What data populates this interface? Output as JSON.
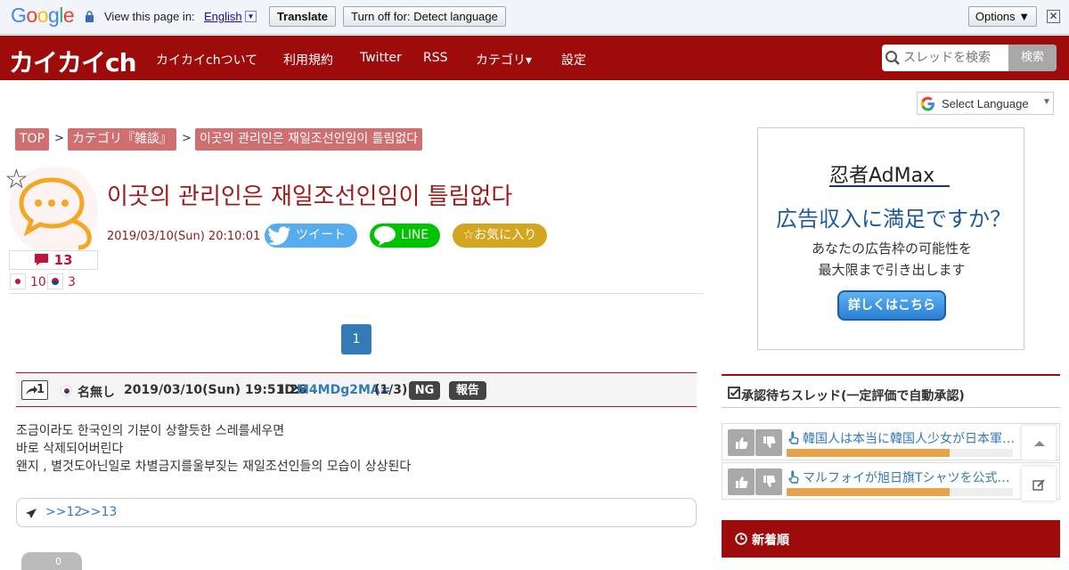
{
  "translate_bar": {
    "google_letters": [
      "G",
      "o",
      "o",
      "g",
      "l",
      "e"
    ],
    "google_colors": [
      "#4285f4",
      "#ea4335",
      "#fbbc05",
      "#4285f4",
      "#34a853",
      "#ea4335"
    ],
    "view_text": "View this page in:",
    "language": "English",
    "translate_label": "Translate",
    "turn_off_label": "Turn off for: Detect language",
    "options_label": "Options ▼",
    "close_label": "✕"
  },
  "header": {
    "logo": "カイカイch",
    "nav": [
      "カイカイchついて",
      "利用規約",
      "Twitter",
      "RSS",
      "カテゴリ▾",
      "設定"
    ],
    "search_placeholder": "スレッドを検索",
    "search_button": "検索",
    "brand_color": "#9e0b0b"
  },
  "select_language": {
    "label": "Select Language",
    "caret": "▼"
  },
  "breadcrumb": {
    "items": [
      "TOP",
      "カテゴリ『雑談』",
      "이곳의 관리인은 재일조선인임이 틀림없다"
    ],
    "separator": ">"
  },
  "thread": {
    "title": "이곳의 관리인은 재일조선인임이 틀림없다",
    "date": "2019/03/10(Sun) 20:10:01",
    "tweet_label": "ツイート",
    "line_label": "LINE",
    "fav_label": "☆お気に入り",
    "comment_count": "13",
    "jp_count": "10",
    "kr_count": "3",
    "star_icon": "☆"
  },
  "pagination": {
    "current": "1"
  },
  "post": {
    "number": "1",
    "name": "名無し",
    "datetime": "2019/03/10(Sun) 19:51:26",
    "id_label": "ID:",
    "id_value": "M4MDg2MA=",
    "id_count": "(1/3)",
    "ng_label": "NG",
    "report_label": "報告",
    "lines": [
      "조금이라도 한국인의 기분이 상할듯한 스레를세우면",
      "바로 삭제되어버린다",
      "왠지 , 별것도아닌일로 차별금지를울부짖는 재일조선인들의 모습이 상상된다"
    ],
    "replies": [
      ">>12",
      ">>13"
    ]
  },
  "ad": {
    "brand": "忍者AdMax",
    "headline": "広告収入に満足ですか？",
    "sub1": "あなたの広告枠の可能性を",
    "sub2": "最大限まで引き出します",
    "button": "詳しくはこちら"
  },
  "sidebar": {
    "pending_title": "承認待ちスレッド(一定評価で自動承認)",
    "pending_items": [
      {
        "title": "韓国人は本当に韓国人少女が日本軍…",
        "rating": 0.72
      },
      {
        "title": "マルフォイが旭日旗Tシャツを公式…",
        "rating": 0.72
      }
    ],
    "newest_title": "新着順"
  },
  "misc": {
    "bottom_partial": "0"
  }
}
